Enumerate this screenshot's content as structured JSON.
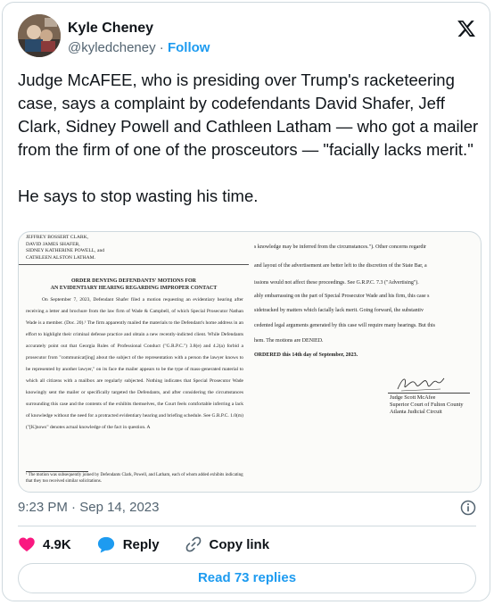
{
  "author": {
    "name": "Kyle Cheney",
    "handle": "@kyledcheney",
    "separator": "·",
    "follow_label": "Follow"
  },
  "brand_icon": "x-logo-icon",
  "tweet_text": "Judge McAFEE, who is presiding over Trump's racketeering case, says a complaint by codefendants David Shafer, Jeff Clark, Sidney Powell and Cathleen Latham — who got a mailer from the firm of one of the prosceutors — \"facially lacks merit.\"\n\nHe says to stop wasting his time.",
  "document": {
    "caption_lines": [
      "JEFFREY BOSSERT CLARK,",
      "DAVID JAMES SHAFER,",
      "SIDNEY KATHERINE POWELL, and",
      "CATHLEEN ALSTON LATHAM."
    ],
    "order_title": [
      "ORDER DENYING DEFENDANTS' MOTIONS FOR",
      "AN EVIDENTIARY HEARING REGARDING IMPROPER CONTACT"
    ],
    "body": "On September 7, 2023, Defendant Shafer filed a motion requesting an evidentiary hearing after receiving a letter and brochure from the law firm of Wade & Campbell, of which Special Prosecutor Nathan Wade is a member. (Doc. 20).¹ The firm apparently mailed the materials to the Defendant's home address in an effort to highlight their criminal defense practice and obtain a new recently-indicted client. While Defendants accurately point out that Georgia Rules of Professional Conduct (\"G.R.P.C.\") 3.8(e) and 4.2(a) forbid a prosecutor from \"communicat[ing] about the subject of the representation with a person the lawyer knows to be represented by another lawyer,\" on its face the mailer appears to be the type of mass-generated material to which all citizens with a mailbox are regularly subjected. Nothing indicates that Special Prosecutor Wade knowingly sent the mailer or specifically targeted the Defendants, and after considering the circumstances surrounding this case and the contents of the exhibits themselves, the Court feels comfortable inferring a lack of knowledge without the need for a protracted evidentiary hearing and briefing schedule. See G.R.P.C. 1.0(m) (\"[K]nows\" denotes actual knowledge of the fact in question. A",
    "footnote": "¹ The motion was subsequently joined by Defendants Clark, Powell, and Latham, each of whom added exhibits indicating that they too received similar solicitations.",
    "right_lines": [
      "s knowledge may be inferred from the circumstances.\"). Other concerns regardir",
      "and layout of the advertisement are better left to the discretion of the State Bar, a",
      "issions would not affect these proceedings. See G.R.P.C. 7.3 (\"Advertising\").",
      "ably embarrassing on the part of Special Prosecutor Wade and his firm, this case s",
      "sidetracked by matters which facially lack merit. Going forward, the substantiv",
      "cedented legal arguments generated by this case will require many hearings. But this",
      "hem. The motions are DENIED.",
      "ORDERED this 14th day of September, 2023."
    ],
    "signature_lines": [
      "Judge Scott McAfee",
      "Superior Court of Fulton County",
      "Atlanta Judicial Circuit"
    ]
  },
  "meta": {
    "time": "9:23 PM",
    "separator": "·",
    "date": "Sep 14, 2023"
  },
  "actions": {
    "like_count": "4.9K",
    "reply_label": "Reply",
    "copy_link_label": "Copy link"
  },
  "read_replies_label": "Read 73 replies",
  "colors": {
    "accent": "#1d9bf0",
    "like": "#f91880",
    "text": "#0f1419",
    "secondary": "#536471",
    "border": "#cfd9de"
  }
}
